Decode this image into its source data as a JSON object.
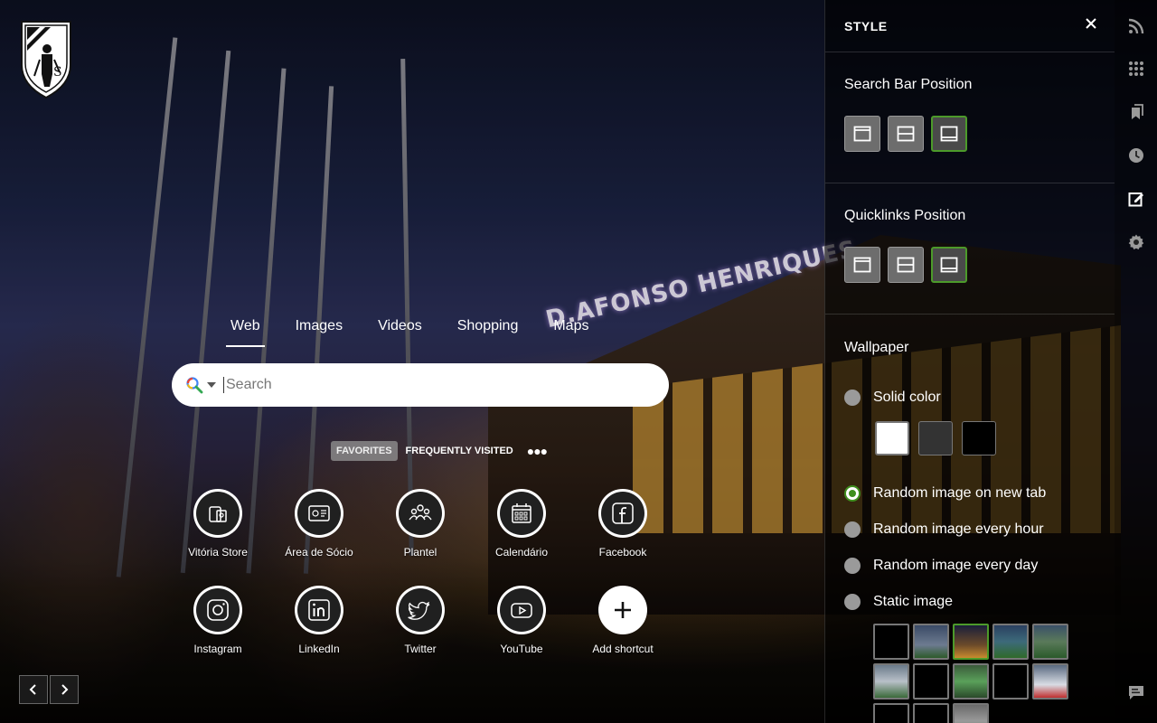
{
  "search": {
    "tabs": [
      {
        "label": "Web",
        "active": true
      },
      {
        "label": "Images",
        "active": false
      },
      {
        "label": "Videos",
        "active": false
      },
      {
        "label": "Shopping",
        "active": false
      },
      {
        "label": "Maps",
        "active": false
      }
    ],
    "placeholder": "Search",
    "engine_icon": "search-icon"
  },
  "wallpaper": {
    "sign_text": "D.AFONSO HENRIQUES"
  },
  "quicklinks": {
    "tabs": [
      {
        "label": "FAVORITES",
        "active": true
      },
      {
        "label": "FREQUENTLY VISITED",
        "active": false
      }
    ],
    "more_icon": "more-dots-icon",
    "shortcuts": [
      {
        "label": "Vitória Store",
        "icon": "store-icon"
      },
      {
        "label": "Área de Sócio",
        "icon": "member-card-icon"
      },
      {
        "label": "Plantel",
        "icon": "team-icon"
      },
      {
        "label": "Calendário",
        "icon": "calendar-icon"
      },
      {
        "label": "Facebook",
        "icon": "facebook-icon"
      },
      {
        "label": "Instagram",
        "icon": "instagram-icon"
      },
      {
        "label": "LinkedIn",
        "icon": "linkedin-icon"
      },
      {
        "label": "Twitter",
        "icon": "twitter-icon"
      },
      {
        "label": "YouTube",
        "icon": "youtube-icon"
      },
      {
        "label": "Add shortcut",
        "icon": "plus-icon"
      }
    ]
  },
  "panel": {
    "title": "STYLE",
    "search_bar_position": {
      "title": "Search Bar Position",
      "options": [
        "top",
        "middle",
        "bottom"
      ],
      "selected": "bottom"
    },
    "quicklinks_position": {
      "title": "Quicklinks Position",
      "options": [
        "top",
        "middle",
        "bottom"
      ],
      "selected": "bottom"
    },
    "wallpaper": {
      "title": "Wallpaper",
      "options": [
        {
          "label": "Solid color",
          "checked": false
        },
        {
          "label": "Random image on new tab",
          "checked": true
        },
        {
          "label": "Random image every hour",
          "checked": false
        },
        {
          "label": "Random image every day",
          "checked": false
        },
        {
          "label": "Static image",
          "checked": false
        }
      ],
      "solid_colors": [
        "#ffffff",
        "#333333",
        "#000000"
      ],
      "thumbnail_count": 13
    }
  },
  "rail": {
    "icons": [
      "rss-icon",
      "apps-grid-icon",
      "bookmarks-icon",
      "history-icon",
      "style-edit-icon",
      "settings-icon",
      "feedback-icon"
    ]
  },
  "colors": {
    "accent_green": "#4c9a2a",
    "panel_bg": "rgba(0,0,0,0.62)"
  }
}
